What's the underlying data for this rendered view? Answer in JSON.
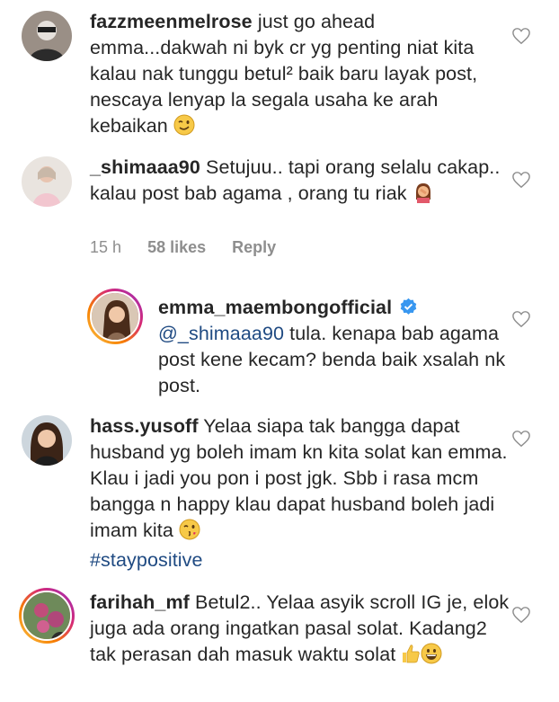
{
  "comments": [
    {
      "username": "fazzmeenmelrose",
      "text": "just go ahead emma...dakwah ni byk cr yg penting niat kita kalau nak tunggu betul² baik baru layak post, nescaya lenyap la segala usaha ke arah kebaikan",
      "emoji": "winking-face"
    },
    {
      "username": "_shimaaa90",
      "text": "Setujuu.. tapi orang selalu cakap.. kalau post bab agama , orang tu riak",
      "emoji": "person-facepalming",
      "time": "15 h",
      "likes": "58 likes",
      "reply": "Reply"
    },
    {
      "username": "emma_maembongofficial",
      "mention": "@_shimaaa90",
      "text": "tula. kenapa bab agama post kene kecam? benda baik xsalah nk post."
    },
    {
      "username": "hass.yusoff",
      "text": "Yelaa siapa tak bangga dapat husband yg boleh imam kn kita solat kan emma. Klau i jadi you pon i post jgk. Sbb i rasa mcm bangga n happy klau dapat husband boleh jadi imam kita",
      "emoji": "face-blowing-kiss",
      "hashtag": "#staypositive"
    },
    {
      "username": "farihah_mf",
      "text": "Betul2.. Yelaa asyik scroll IG je, elok juga ada orang ingatkan pasal solat. Kadang2 tak perasan dah masuk waktu solat",
      "emoji_1": "thumbs-up",
      "emoji_2": "grinning-face"
    }
  ],
  "colors": {
    "text": "#262626",
    "meta": "#8e8e8e",
    "link": "#1f4a82",
    "verified": "#3897f0"
  }
}
